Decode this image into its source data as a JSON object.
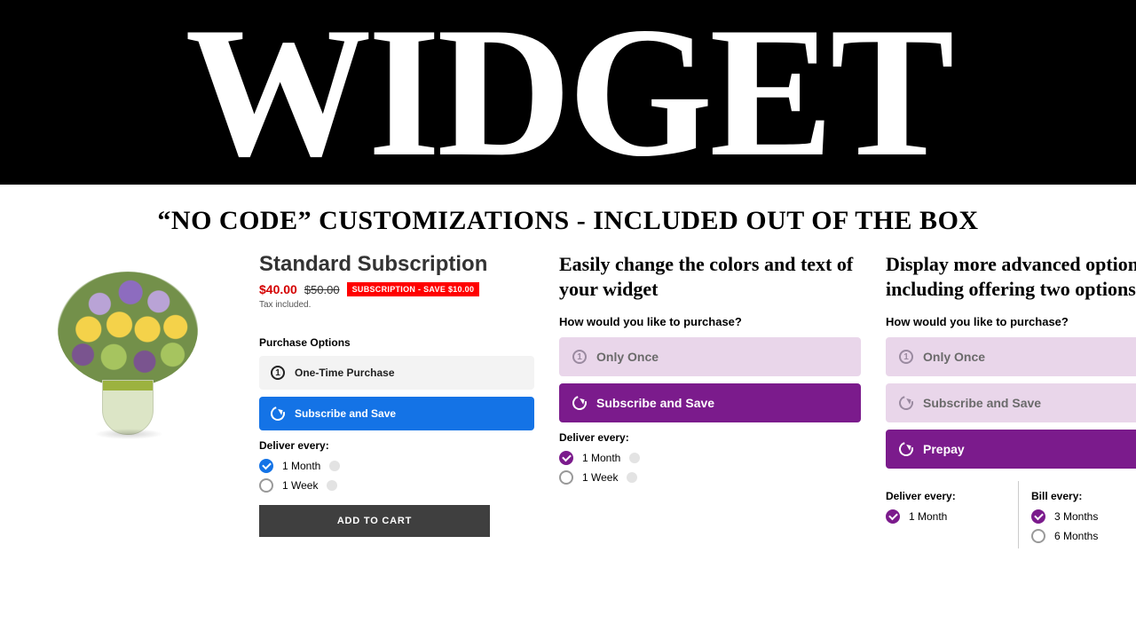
{
  "hero": {
    "title": "WIDGET"
  },
  "subhead": "“NO CODE” CUSTOMIZATIONS - INCLUDED OUT OF THE BOX",
  "product": {
    "title": "Standard Subscription",
    "price": "$40.00",
    "compare_at": "$50.00",
    "badge": "SUBSCRIPTION - SAVE $10.00",
    "tax_text": "Tax included."
  },
  "default_widget": {
    "purchase_options_label": "Purchase Options",
    "one_time": "One-Time Purchase",
    "subscribe": "Subscribe and Save",
    "deliver_label": "Deliver every:",
    "intervals": [
      {
        "label": "1 Month",
        "selected": true
      },
      {
        "label": "1 Week",
        "selected": false
      }
    ],
    "add_to_cart": "ADD TO CART"
  },
  "color_variant": {
    "heading": "Easily change the colors and text of your widget",
    "prompt": "How would you like to purchase?",
    "only_once": "Only Once",
    "subscribe": "Subscribe and Save",
    "deliver_label": "Deliver every:",
    "intervals": [
      {
        "label": "1 Month",
        "selected": true
      },
      {
        "label": "1 Week",
        "selected": false
      }
    ]
  },
  "advanced_variant": {
    "heading": "Display more advanced options, including offering two options",
    "prompt": "How would you like to purchase?",
    "only_once": "Only Once",
    "subscribe": "Subscribe and Save",
    "prepay": "Prepay",
    "deliver_label": "Deliver every:",
    "deliver_intervals": [
      {
        "label": "1 Month",
        "selected": true
      }
    ],
    "bill_label": "Bill every:",
    "bill_intervals": [
      {
        "label": "3 Months",
        "selected": true
      },
      {
        "label": "6 Months",
        "selected": false
      }
    ]
  },
  "colors": {
    "blue": "#1473e6",
    "purple": "#7b1b8c",
    "lavender": "#e9d6ea",
    "badge_red": "#ff0000",
    "price_red": "#d40000"
  }
}
